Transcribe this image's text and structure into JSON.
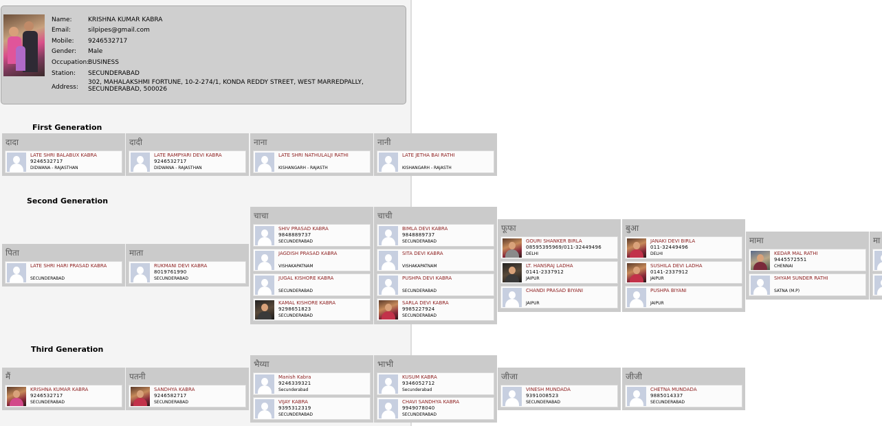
{
  "profile": {
    "labels": {
      "name": "Name:",
      "email": "Email:",
      "mobile": "Mobile:",
      "gender": "Gender:",
      "occupation": "Occupation:",
      "station": "Station:",
      "address": "Address:"
    },
    "name": "KRISHNA KUMAR KABRA",
    "email": "silpipes@gmail.com",
    "mobile": "9246532717",
    "gender": "Male",
    "occupation": "BUSINESS",
    "station": "SECUNDERABAD",
    "address": "302, MAHALAKSHMI FORTUNE, 10-2-274/1, KONDA REDDY STREET, WEST MARREDPALLY, SECUNDERABAD, 500026"
  },
  "generations": {
    "first": "First Generation",
    "second": "Second Generation",
    "third": "Third Generation"
  },
  "groups": {
    "dada": {
      "title": "दादा",
      "members": [
        {
          "name": "LATE SHRI BALABUX KABRA",
          "phone": "9246532717",
          "city": "DIDWANA - RAJASTHAN"
        }
      ]
    },
    "dadi": {
      "title": "दादी",
      "members": [
        {
          "name": "LATE RAMPYARI DEVI KABRA",
          "phone": "9246532717",
          "city": "DIDWANA - RAJASTHAN"
        }
      ]
    },
    "nana": {
      "title": "नाना",
      "members": [
        {
          "name": "LATE SHRI NATHULALJI RATHI",
          "phone": "",
          "city": "KISHANGARH - RAJASTH"
        }
      ]
    },
    "nani": {
      "title": "नानी",
      "members": [
        {
          "name": "LATE JETHA BAI RATHI",
          "phone": "",
          "city": "KISHANGARH - RAJASTH"
        }
      ]
    },
    "pita": {
      "title": "पिता",
      "members": [
        {
          "name": "LATE SHRI HARI PRASAD KABRA",
          "phone": "",
          "city": "SECUNDERABAD"
        }
      ]
    },
    "mata": {
      "title": "माता",
      "members": [
        {
          "name": "RUKMANI DEVI KABRA",
          "phone": "8019761990",
          "city": "SECUNDERABAD"
        }
      ]
    },
    "chacha": {
      "title": "चाचा",
      "members": [
        {
          "name": "SHIV PRASAD KABRA",
          "phone": "9848889737",
          "city": "SECUNDERABAD"
        },
        {
          "name": "JAGDISH PRASAD KABRA",
          "phone": "",
          "city": "VISHAKAPATNAM"
        },
        {
          "name": "JUGAL KISHORE KABRA",
          "phone": "",
          "city": "SECUNDERABAD"
        },
        {
          "name": "KAMAL KISHORE KABRA",
          "phone": "9298651823",
          "city": "SECUNDERABAD"
        }
      ]
    },
    "chachi": {
      "title": "चाची",
      "members": [
        {
          "name": "BIMLA DEVI KABRA",
          "phone": "9848889737",
          "city": "SECUNDERABAD"
        },
        {
          "name": "SITA DEVI KABRA",
          "phone": "",
          "city": "VISHAKAPATNAM"
        },
        {
          "name": "PUSHPA DEVI KABRA",
          "phone": "",
          "city": "SECUNDERABAD"
        },
        {
          "name": "SARLA DEVI KABRA",
          "phone": "9985227924",
          "city": "SECUNDERABAD"
        }
      ]
    },
    "fufa": {
      "title": "फूफा",
      "members": [
        {
          "name": "GOURI SHANKER BIRLA",
          "phone": "08595395969/011-32449496",
          "city": "DELHI"
        },
        {
          "name": "LT. HANSRAJ LADHA",
          "phone": "0141-2337912",
          "city": "JAIPUR"
        },
        {
          "name": "CHANDI PRASAD BIYANI",
          "phone": "",
          "city": "JAIPUR"
        }
      ]
    },
    "bua": {
      "title": "बुआ",
      "members": [
        {
          "name": "JANAKI DEVI BIRLA",
          "phone": "011-32449496",
          "city": "DELHI"
        },
        {
          "name": "SUSHILA DEVI LADHA",
          "phone": "0141-2337912",
          "city": "JAIPUR"
        },
        {
          "name": "PUSHPA BIYANI",
          "phone": "",
          "city": "JAIPUR"
        }
      ]
    },
    "mama": {
      "title": "मामा",
      "members": [
        {
          "name": "KEDAR MAL RATHI",
          "phone": "9445572551",
          "city": "CHENNAI"
        },
        {
          "name": "SHYAM SUNDER RATHI",
          "phone": "",
          "city": "SATNA (M.P)"
        }
      ]
    },
    "mami": {
      "title": "मा"
    },
    "main": {
      "title": "मैं",
      "members": [
        {
          "name": "KRISHNA KUMAR KABRA",
          "phone": "9246532717",
          "city": "SECUNDERABAD"
        }
      ]
    },
    "patni": {
      "title": "पतनी",
      "members": [
        {
          "name": "SANDHYA KABRA",
          "phone": "9246582717",
          "city": "SECUNDERABAD"
        }
      ]
    },
    "bhaiya": {
      "title": "भैय्या",
      "members": [
        {
          "name": "Manish Kabra",
          "phone": "9246339321",
          "city": "Secunderabad"
        },
        {
          "name": "VIJAY KABRA",
          "phone": "9395312319",
          "city": "SECUNDERABAD"
        }
      ]
    },
    "bhabhi": {
      "title": "भाभी",
      "members": [
        {
          "name": "KUSUM KABRA",
          "phone": "9346052712",
          "city": "Secunderabad"
        },
        {
          "name": "CHAVI SANDHYA KABRA",
          "phone": "9949078040",
          "city": "SECUNDERABAD"
        }
      ]
    },
    "jija": {
      "title": "जीजा",
      "members": [
        {
          "name": "VINESH MUNDADA",
          "phone": "9391008523",
          "city": "SECUNDERABAD"
        }
      ]
    },
    "jiji": {
      "title": "जीजी",
      "members": [
        {
          "name": "CHETNA MUNDADA",
          "phone": "9885014337",
          "city": "SECUNDERABAD"
        }
      ]
    }
  }
}
